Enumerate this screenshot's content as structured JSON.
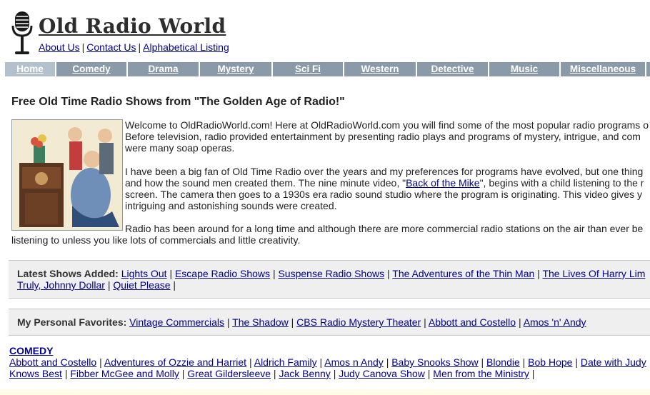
{
  "site": {
    "title": "Old Radio World",
    "links": [
      "About Us",
      "Contact Us",
      "Alphabetical Listing"
    ]
  },
  "nav": {
    "items": [
      "Home",
      "Comedy",
      "Drama",
      "Mystery",
      "Sci Fi",
      "Western",
      "Detective",
      "Music",
      "Miscellaneous"
    ],
    "active": "Home"
  },
  "main": {
    "heading": "Free Old Time Radio Shows from \"The Golden Age of Radio!\"",
    "para1": [
      "Welcome to OldRadioWorld.com! Here at OldRadioWorld.com you will find some of the most popular radio programs o",
      "Before television, radio provided entertainment by presenting radio plays and programs of mystery, intrigue, and com",
      "were many soap operas."
    ],
    "para2_line1": "I have been a big fan of Old Time Radio over the years and my preferences for programs have evolved, but one thing",
    "para2_line2_pre": "and how the sound men created them. The nine minute video, \"",
    "para2_link": "Back of the Mike",
    "para2_line2_post": "\", begins with a child listening to the r",
    "para2_rest": [
      "screen. The camera then goes to a 1930s era radio sound studio where the program is originating. This video gives y",
      "intriguing and astonishing sounds were created."
    ],
    "para3": [
      "Radio has been around for a long time and although there are more commercial radio stations on the air than ever be",
      "listening to unless you like lots of commercials and little creativity."
    ]
  },
  "latest": {
    "label": "Latest Shows Added:",
    "line1": [
      "Lights Out",
      "Escape Radio Shows",
      "Suspense Radio Shows",
      "The Adventures of the Thin Man",
      "The Lives Of Harry Lim"
    ],
    "line2": [
      "Truly, Johnny Dollar",
      "Quiet Please"
    ]
  },
  "favorites": {
    "label": "My Personal Favorites:",
    "items": [
      "Vintage Commercials",
      "The Shadow",
      "CBS Radio Mystery Theater",
      "Abbott and Costello",
      "Amos 'n' Andy"
    ]
  },
  "comedy": {
    "title": "COMEDY",
    "line1": [
      "Abbott and Costello",
      "Adventures of Ozzie and Harriet",
      "Aldrich Family",
      "Amos n Andy",
      "Baby Snooks Show",
      "Blondie",
      "Bob Hope",
      "Date with Judy"
    ],
    "line2": [
      "Knows Best",
      "Fibber McGee and Molly",
      "Great Gildersleeve",
      "Jack Benny",
      "Judy Canova Show",
      "Men from the Ministry"
    ]
  },
  "colors": {
    "link": "#00008b",
    "nav_bg": "#8a9aa8",
    "nav_active_bg": "#b3c1cc",
    "box_bg": "#efefef"
  },
  "icons": {
    "logo": "microphone-icon",
    "photo": "vintage-radio-illustration"
  }
}
